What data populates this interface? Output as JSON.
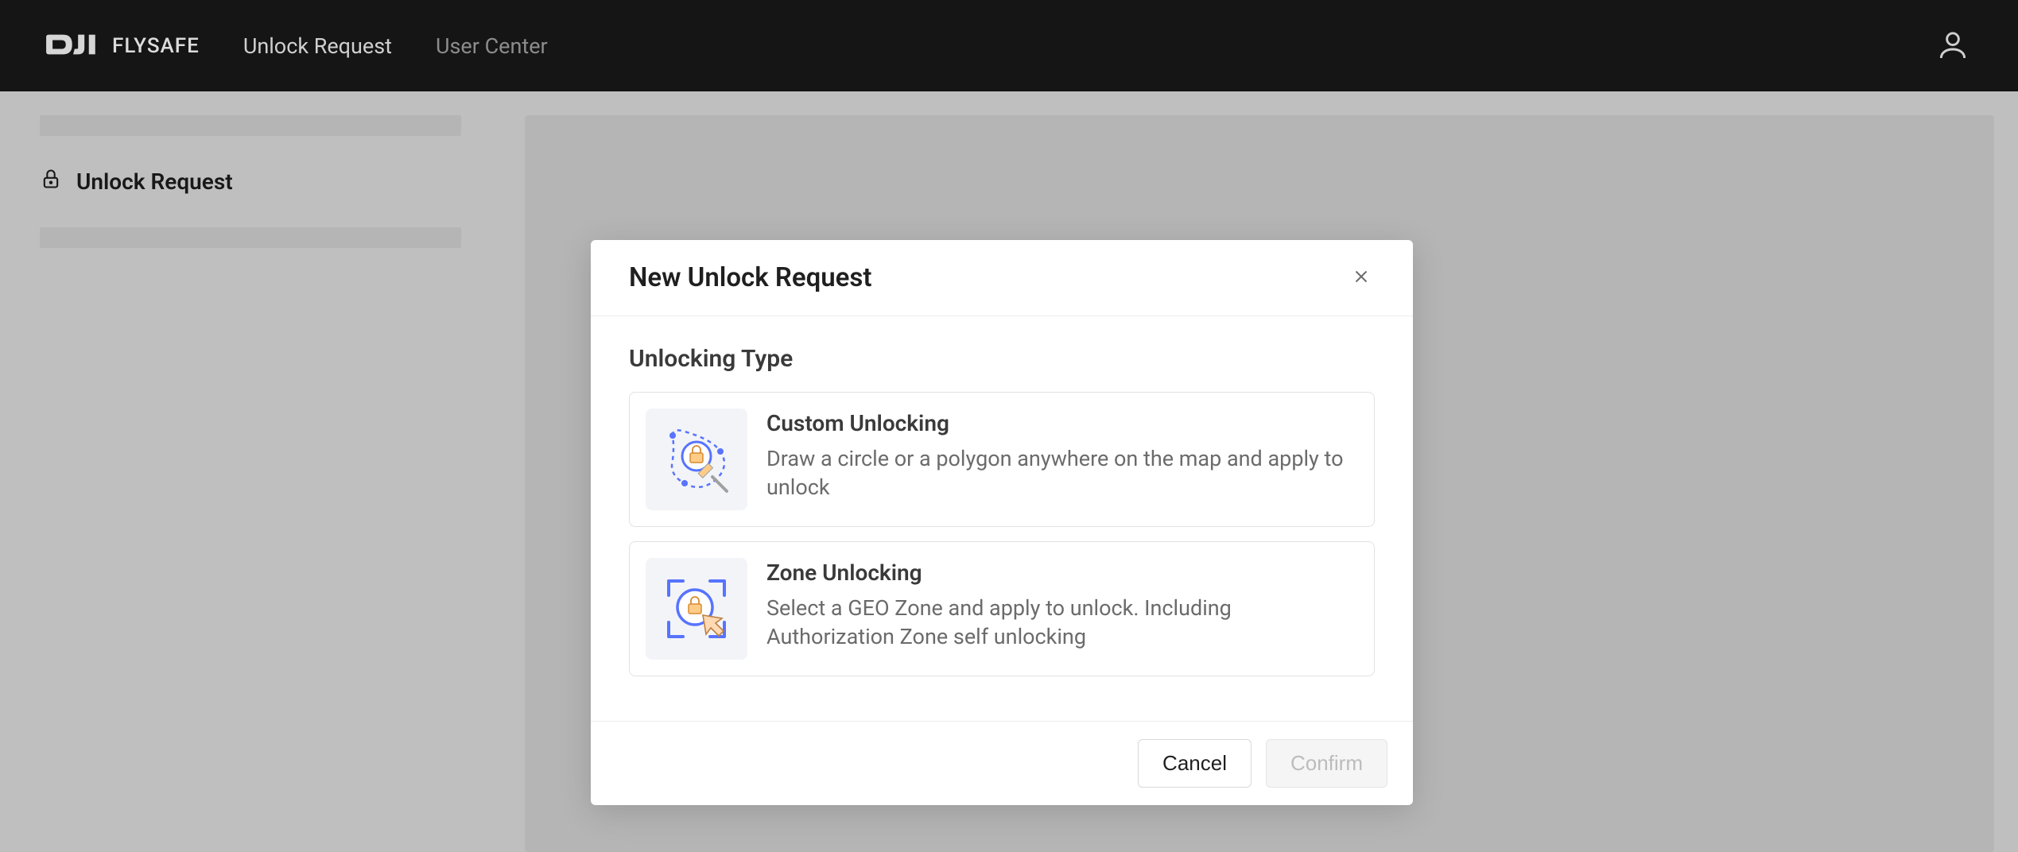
{
  "header": {
    "logo_text": "FLYSAFE",
    "nav": {
      "unlock_request": "Unlock Request",
      "user_center": "User Center"
    }
  },
  "sidebar": {
    "item_label": "Unlock Request"
  },
  "modal": {
    "title": "New Unlock Request",
    "section_title": "Unlocking Type",
    "options": {
      "custom": {
        "title": "Custom Unlocking",
        "desc": "Draw a circle or a polygon anywhere on the map and apply to unlock"
      },
      "zone": {
        "title": "Zone Unlocking",
        "desc": "Select a GEO Zone and apply to unlock. Including Authorization Zone self unlocking"
      }
    },
    "footer": {
      "cancel": "Cancel",
      "confirm": "Confirm"
    }
  }
}
